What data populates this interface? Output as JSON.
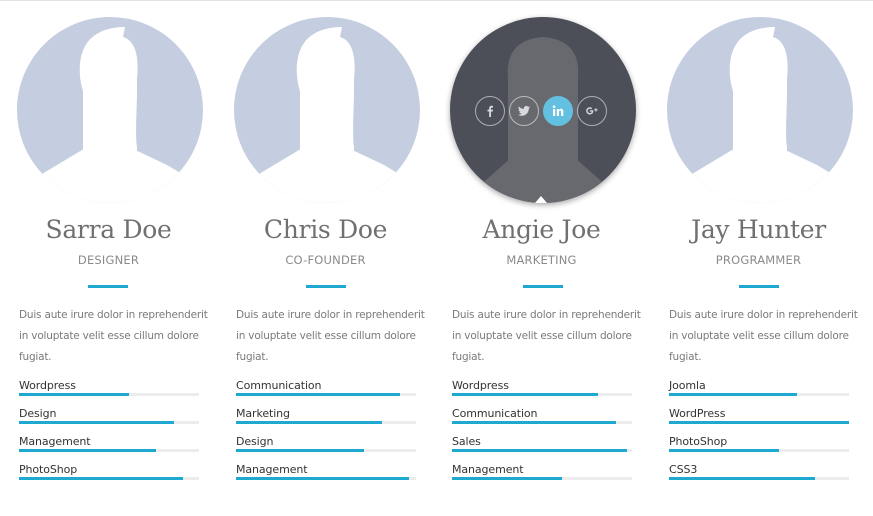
{
  "members": [
    {
      "name": "Sarra Doe",
      "role": "DESIGNER",
      "description": "Duis aute irure dolor in reprehenderit in voluptate velit esse cillum dolore fugiat.",
      "skills": [
        {
          "label": "Wordpress",
          "level": 0.61
        },
        {
          "label": "Design",
          "level": 0.86
        },
        {
          "label": "Management",
          "level": 0.76
        },
        {
          "label": "PhotoShop",
          "level": 0.91
        }
      ]
    },
    {
      "name": "Chris Doe",
      "role": "CO-FOUNDER",
      "description": "Duis aute irure dolor in reprehenderit in voluptate velit esse cillum dolore fugiat.",
      "skills": [
        {
          "label": "Communication",
          "level": 0.91
        },
        {
          "label": "Marketing",
          "level": 0.81
        },
        {
          "label": "Design",
          "level": 0.71
        },
        {
          "label": "Management",
          "level": 0.96
        }
      ]
    },
    {
      "name": "Angie Joe",
      "role": "MARKETING",
      "description": "Duis aute irure dolor in reprehenderit in voluptate velit esse cillum dolore fugiat.",
      "skills": [
        {
          "label": "Wordpress",
          "level": 0.81
        },
        {
          "label": "Communication",
          "level": 0.91
        },
        {
          "label": "Sales",
          "level": 0.97
        },
        {
          "label": "Management",
          "level": 0.61
        }
      ],
      "social_icons": [
        "facebook-icon",
        "twitter-icon",
        "linkedin-icon",
        "google-plus-icon"
      ],
      "active_social": "linkedin-icon"
    },
    {
      "name": "Jay Hunter",
      "role": "PROGRAMMER",
      "description": "Duis aute irure dolor in reprehenderit in voluptate velit esse cillum dolore fugiat.",
      "skills": [
        {
          "label": "Joomla",
          "level": 0.71
        },
        {
          "label": "WordPress",
          "level": 1.0
        },
        {
          "label": "PhotoShop",
          "level": 0.61
        },
        {
          "label": "CSS3",
          "level": 0.81
        }
      ]
    }
  ],
  "colors": {
    "accent": "#1ea9d1",
    "photo_bg": "#c5cde0",
    "silhouette": "#ffffff",
    "active_photo_bg": "#4c4f57",
    "active_silhouette": "#67696e",
    "social_highlight": "#64c0e0"
  }
}
